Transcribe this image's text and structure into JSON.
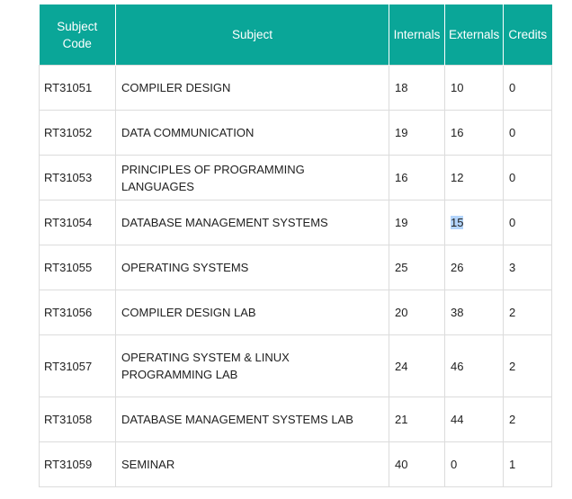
{
  "table": {
    "headers": {
      "code": "Subject Code",
      "subject": "Subject",
      "internals": "Internals",
      "externals": "Externals",
      "credits": "Credits"
    },
    "rows": [
      {
        "code": "RT31051",
        "subject": "COMPILER DESIGN",
        "internals": "18",
        "externals": "10",
        "credits": "0"
      },
      {
        "code": "RT31052",
        "subject": "DATA COMMUNICATION",
        "internals": "19",
        "externals": "16",
        "credits": "0"
      },
      {
        "code": "RT31053",
        "subject": "PRINCIPLES OF PROGRAMMING LANGUAGES",
        "internals": "16",
        "externals": "12",
        "credits": "0"
      },
      {
        "code": "RT31054",
        "subject": "DATABASE MANAGEMENT SYSTEMS",
        "internals": "19",
        "externals": "15",
        "credits": "0"
      },
      {
        "code": "RT31055",
        "subject": "OPERATING SYSTEMS",
        "internals": "25",
        "externals": "26",
        "credits": "3"
      },
      {
        "code": "RT31056",
        "subject": "COMPILER DESIGN LAB",
        "internals": "20",
        "externals": "38",
        "credits": "2"
      },
      {
        "code": "RT31057",
        "subject": "OPERATING SYSTEM & LINUX PROGRAMMING LAB",
        "internals": "24",
        "externals": "46",
        "credits": "2"
      },
      {
        "code": "RT31058",
        "subject": "DATABASE MANAGEMENT SYSTEMS LAB",
        "internals": "21",
        "externals": "44",
        "credits": "2"
      },
      {
        "code": "RT31059",
        "subject": "SEMINAR",
        "internals": "40",
        "externals": "0",
        "credits": "1"
      }
    ]
  },
  "colors": {
    "header_bg": "#0aa698",
    "header_text": "#ffffff",
    "selection_highlight": "#b3d4fc"
  }
}
